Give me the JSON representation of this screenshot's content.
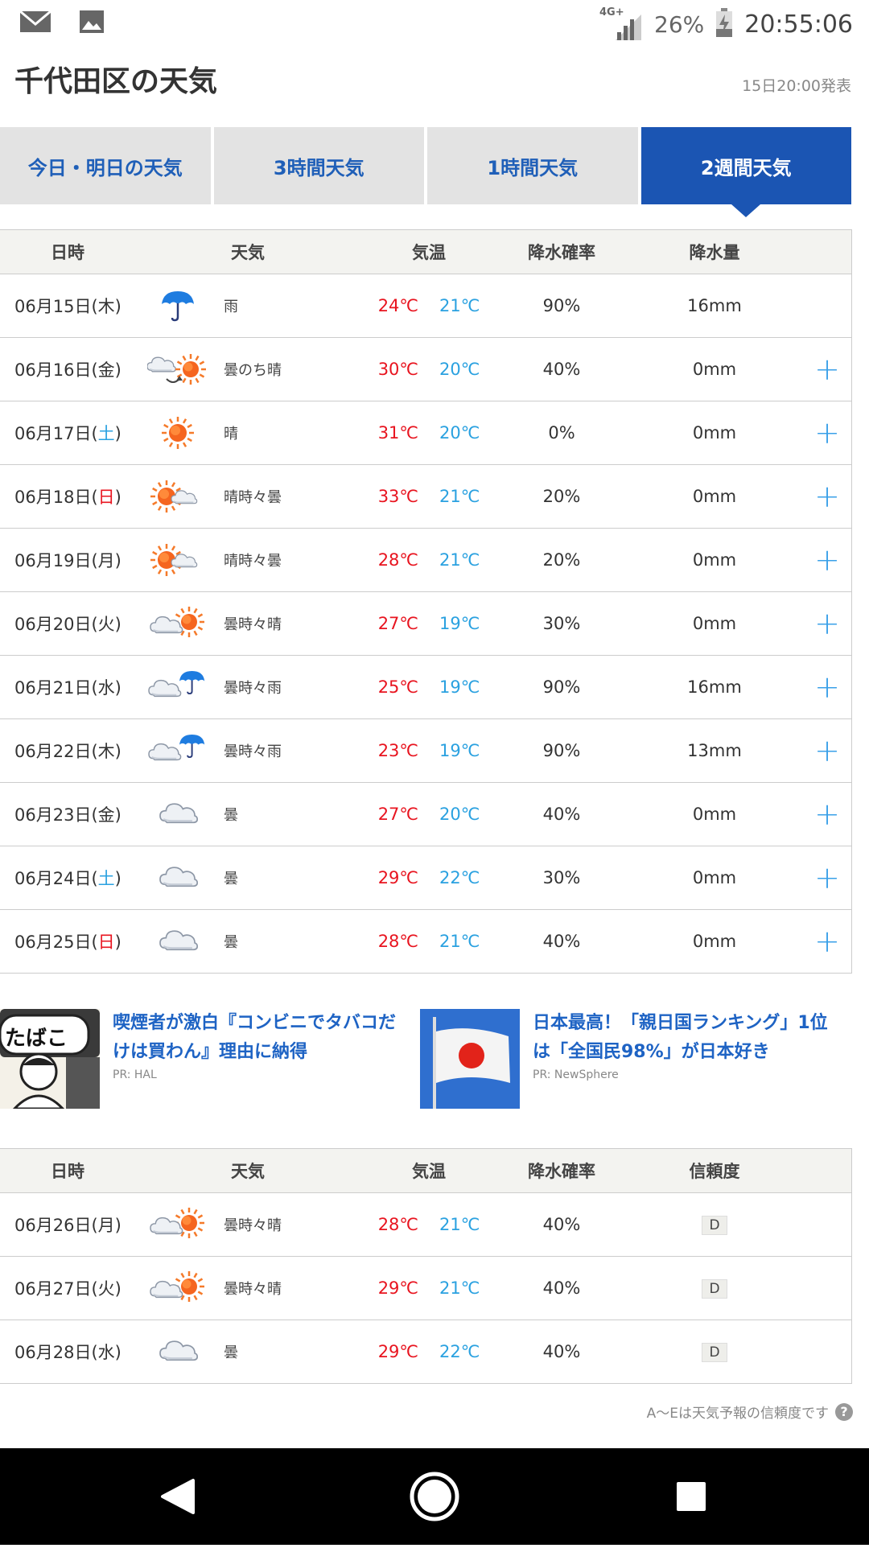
{
  "status_bar": {
    "network": "4G+",
    "battery": "26%",
    "time": "20:55:06"
  },
  "header": {
    "title": "千代田区の天気",
    "announced": "15日20:00発表"
  },
  "tabs": [
    {
      "label": "今日・明日の天気",
      "active": false
    },
    {
      "label": "3時間天気",
      "active": false
    },
    {
      "label": "1時間天気",
      "active": false
    },
    {
      "label": "2週間天気",
      "active": true
    }
  ],
  "table1": {
    "headers": [
      "日時",
      "天気",
      "気温",
      "降水確率",
      "降水量"
    ],
    "rows": [
      {
        "date": "06月15日(",
        "dow": "木",
        "dow_type": "weekday",
        "close": ")",
        "icon": "umbrella-icon",
        "weather": "雨",
        "hi": "24℃",
        "lo": "21℃",
        "prob": "90%",
        "amount": "16mm",
        "plus": ""
      },
      {
        "date": "06月16日(",
        "dow": "金",
        "dow_type": "weekday",
        "close": ")",
        "icon": "cloud-then-sun-icon",
        "weather": "曇のち晴",
        "hi": "30℃",
        "lo": "20℃",
        "prob": "40%",
        "amount": "0mm",
        "plus": "+"
      },
      {
        "date": "06月17日(",
        "dow": "土",
        "dow_type": "sat",
        "close": ")",
        "icon": "sun-icon",
        "weather": "晴",
        "hi": "31℃",
        "lo": "20℃",
        "prob": "0%",
        "amount": "0mm",
        "plus": "+"
      },
      {
        "date": "06月18日(",
        "dow": "日",
        "dow_type": "sun",
        "close": ")",
        "icon": "sun-sometimes-cloud-icon",
        "weather": "晴時々曇",
        "hi": "33℃",
        "lo": "21℃",
        "prob": "20%",
        "amount": "0mm",
        "plus": "+"
      },
      {
        "date": "06月19日(",
        "dow": "月",
        "dow_type": "weekday",
        "close": ")",
        "icon": "sun-sometimes-cloud-icon",
        "weather": "晴時々曇",
        "hi": "28℃",
        "lo": "21℃",
        "prob": "20%",
        "amount": "0mm",
        "plus": "+"
      },
      {
        "date": "06月20日(",
        "dow": "火",
        "dow_type": "weekday",
        "close": ")",
        "icon": "cloud-sometimes-sun-icon",
        "weather": "曇時々晴",
        "hi": "27℃",
        "lo": "19℃",
        "prob": "30%",
        "amount": "0mm",
        "plus": "+"
      },
      {
        "date": "06月21日(",
        "dow": "水",
        "dow_type": "weekday",
        "close": ")",
        "icon": "cloud-sometimes-rain-icon",
        "weather": "曇時々雨",
        "hi": "25℃",
        "lo": "19℃",
        "prob": "90%",
        "amount": "16mm",
        "plus": "+"
      },
      {
        "date": "06月22日(",
        "dow": "木",
        "dow_type": "weekday",
        "close": ")",
        "icon": "cloud-sometimes-rain-icon",
        "weather": "曇時々雨",
        "hi": "23℃",
        "lo": "19℃",
        "prob": "90%",
        "amount": "13mm",
        "plus": "+"
      },
      {
        "date": "06月23日(",
        "dow": "金",
        "dow_type": "weekday",
        "close": ")",
        "icon": "cloud-icon",
        "weather": "曇",
        "hi": "27℃",
        "lo": "20℃",
        "prob": "40%",
        "amount": "0mm",
        "plus": "+"
      },
      {
        "date": "06月24日(",
        "dow": "土",
        "dow_type": "sat",
        "close": ")",
        "icon": "cloud-icon",
        "weather": "曇",
        "hi": "29℃",
        "lo": "22℃",
        "prob": "30%",
        "amount": "0mm",
        "plus": "+"
      },
      {
        "date": "06月25日(",
        "dow": "日",
        "dow_type": "sun",
        "close": ")",
        "icon": "cloud-icon",
        "weather": "曇",
        "hi": "28℃",
        "lo": "21℃",
        "prob": "40%",
        "amount": "0mm",
        "plus": "+"
      }
    ]
  },
  "ads": [
    {
      "headline": "喫煙者が激白『コンビニでタバコだけは買わん』理由に納得",
      "pr": "PR: HAL",
      "thumb_text": "たばこ",
      "thumb": "tobacco-shop-illustration"
    },
    {
      "headline": "日本最高！「親日国ランキング」1位は「全国民98%」が日本好き",
      "pr": "PR: NewSphere",
      "thumb": "japan-flag-photo"
    }
  ],
  "table2": {
    "headers": [
      "日時",
      "天気",
      "気温",
      "降水確率",
      "信頼度"
    ],
    "rows": [
      {
        "date": "06月26日(",
        "dow": "月",
        "dow_type": "weekday",
        "close": ")",
        "icon": "cloud-sometimes-sun-icon",
        "weather": "曇時々晴",
        "hi": "28℃",
        "lo": "21℃",
        "prob": "40%",
        "reliability": "D"
      },
      {
        "date": "06月27日(",
        "dow": "火",
        "dow_type": "weekday",
        "close": ")",
        "icon": "cloud-sometimes-sun-icon",
        "weather": "曇時々晴",
        "hi": "29℃",
        "lo": "21℃",
        "prob": "40%",
        "reliability": "D"
      },
      {
        "date": "06月28日(",
        "dow": "水",
        "dow_type": "weekday",
        "close": ")",
        "icon": "cloud-icon",
        "weather": "曇",
        "hi": "29℃",
        "lo": "22℃",
        "prob": "40%",
        "reliability": "D"
      }
    ]
  },
  "footnote": {
    "text": "A〜Eは天気予報の信頼度です",
    "help": "?"
  },
  "colors": {
    "accent": "#1b55b3",
    "high_temp": "#e8141f",
    "low_temp": "#2aa1e0",
    "plus": "#3aa0e8"
  }
}
